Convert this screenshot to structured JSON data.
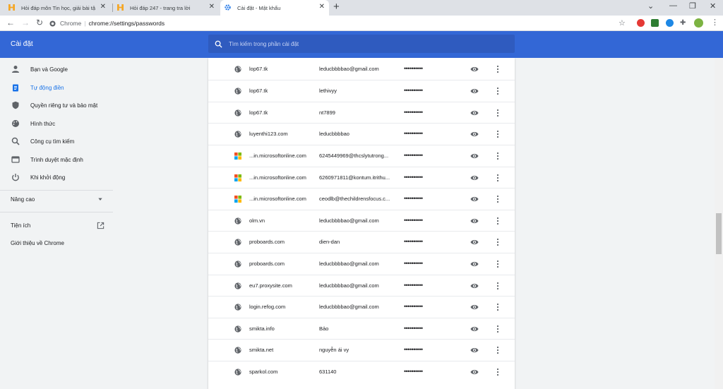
{
  "tabs": [
    {
      "title": "Hỏi đáp môn Tin học, giải bài tậ",
      "active": false
    },
    {
      "title": "Hỏi đáp 247 - trang tra lời",
      "active": false
    },
    {
      "title": "Cài đặt - Mật khẩu",
      "active": true
    }
  ],
  "toolbar": {
    "site_label": "Chrome",
    "url": "chrome://settings/passwords"
  },
  "header": {
    "app_title": "Cài đặt",
    "search_placeholder": "Tìm kiếm trong phần cài đặt"
  },
  "sidebar": {
    "items": [
      {
        "label": "Bạn và Google",
        "icon": "person-icon"
      },
      {
        "label": "Tự động điền",
        "icon": "clipboard-icon"
      },
      {
        "label": "Quyền riêng tư và bảo mật",
        "icon": "shield-icon"
      },
      {
        "label": "Hình thức",
        "icon": "palette-icon"
      },
      {
        "label": "Công cụ tìm kiếm",
        "icon": "search-icon"
      },
      {
        "label": "Trình duyệt mặc định",
        "icon": "browser-icon"
      },
      {
        "label": "Khi khởi động",
        "icon": "power-icon"
      }
    ],
    "advanced_label": "Nâng cao",
    "extensions_label": "Tiện ích",
    "about_label": "Giới thiệu về Chrome"
  },
  "passwords": [
    {
      "site": "lop67.tk",
      "user": "leducbbbbao@gmail.com",
      "icon": "globe",
      "password": "••••••••••"
    },
    {
      "site": "lop67.tk",
      "user": "lethivyy",
      "icon": "globe",
      "password": "••••••••••"
    },
    {
      "site": "lop67.tk",
      "user": "nt7899",
      "icon": "globe",
      "password": "••••••••••"
    },
    {
      "site": "luyenthi123.com",
      "user": "leducbbbbao",
      "icon": "globe",
      "password": "••••••••••"
    },
    {
      "site": "...in.microsoftonline.com",
      "user": "6245449969@thcslytutrong...",
      "icon": "microsoft",
      "password": "••••••••••"
    },
    {
      "site": "...in.microsoftonline.com",
      "user": "6260971811@kontum.itrithu...",
      "icon": "microsoft",
      "password": "••••••••••"
    },
    {
      "site": "...in.microsoftonline.com",
      "user": "ceodlb@thechildrensfocus.c...",
      "icon": "microsoft",
      "password": "••••••••••"
    },
    {
      "site": "olm.vn",
      "user": "leducbbbbao@gmail.com",
      "icon": "globe",
      "password": "••••••••••"
    },
    {
      "site": "proboards.com",
      "user": "dien-dan",
      "icon": "globe",
      "password": "••••••••••"
    },
    {
      "site": "proboards.com",
      "user": "leducbbbbao@gmail.com",
      "icon": "globe",
      "password": "••••••••••"
    },
    {
      "site": "eu7.proxysite.com",
      "user": "leducbbbbao@gmail.com",
      "icon": "globe",
      "password": "••••••••••"
    },
    {
      "site": "login.refog.com",
      "user": "leducbbbbao@gmail.com",
      "icon": "globe",
      "password": "••••••••••"
    },
    {
      "site": "smikta.info",
      "user": "Bảo",
      "icon": "globe",
      "password": "••••••••••"
    },
    {
      "site": "smikta.net",
      "user": "nguyễn ái vy",
      "icon": "globe",
      "password": "••••••••••"
    },
    {
      "site": "sparkol.com",
      "user": "631140",
      "icon": "globe",
      "password": "••••••••••"
    }
  ],
  "colors": {
    "header_blue": "#3367d6",
    "search_bg": "#2f5bbf",
    "active_blue": "#1a73e8"
  }
}
